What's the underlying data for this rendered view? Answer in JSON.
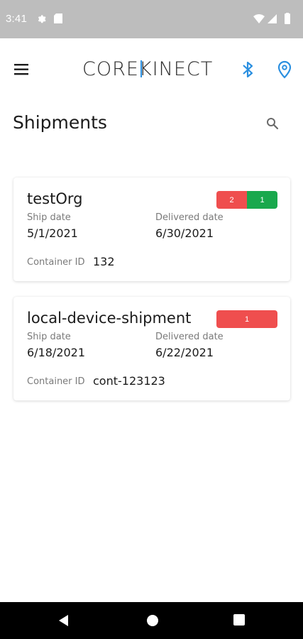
{
  "status_bar": {
    "time": "3:41",
    "icons": [
      "settings-icon",
      "sd-card-icon",
      "wifi-icon",
      "signal-icon",
      "battery-icon"
    ]
  },
  "toolbar": {
    "menu_icon": "menu-icon",
    "logo_text_left": "CORE",
    "logo_text_k": "K",
    "logo_text_right": "INECT",
    "bluetooth_icon": "bluetooth-icon",
    "location_icon": "location-pin-icon",
    "accent_color": "#2a8fe0"
  },
  "page": {
    "title": "Shipments",
    "search_icon": "search-icon"
  },
  "shipments": [
    {
      "name": "testOrg",
      "badges": [
        {
          "count": "2",
          "color": "#ef4e4e"
        },
        {
          "count": "1",
          "color": "#19a84d"
        }
      ],
      "ship_date_label": "Ship date",
      "ship_date": "5/1/2021",
      "delivered_date_label": "Delivered date",
      "delivered_date": "6/30/2021",
      "container_label": "Container ID",
      "container_id": "132"
    },
    {
      "name": "local-device-shipment",
      "badges": [
        {
          "count": "1",
          "color": "#ef4e4e"
        }
      ],
      "ship_date_label": "Ship date",
      "ship_date": "6/18/2021",
      "delivered_date_label": "Delivered date",
      "delivered_date": "6/22/2021",
      "container_label": "Container ID",
      "container_id": "cont-123123"
    }
  ],
  "nav_bar": {
    "icons": [
      "back-icon",
      "home-icon",
      "recents-icon"
    ]
  }
}
